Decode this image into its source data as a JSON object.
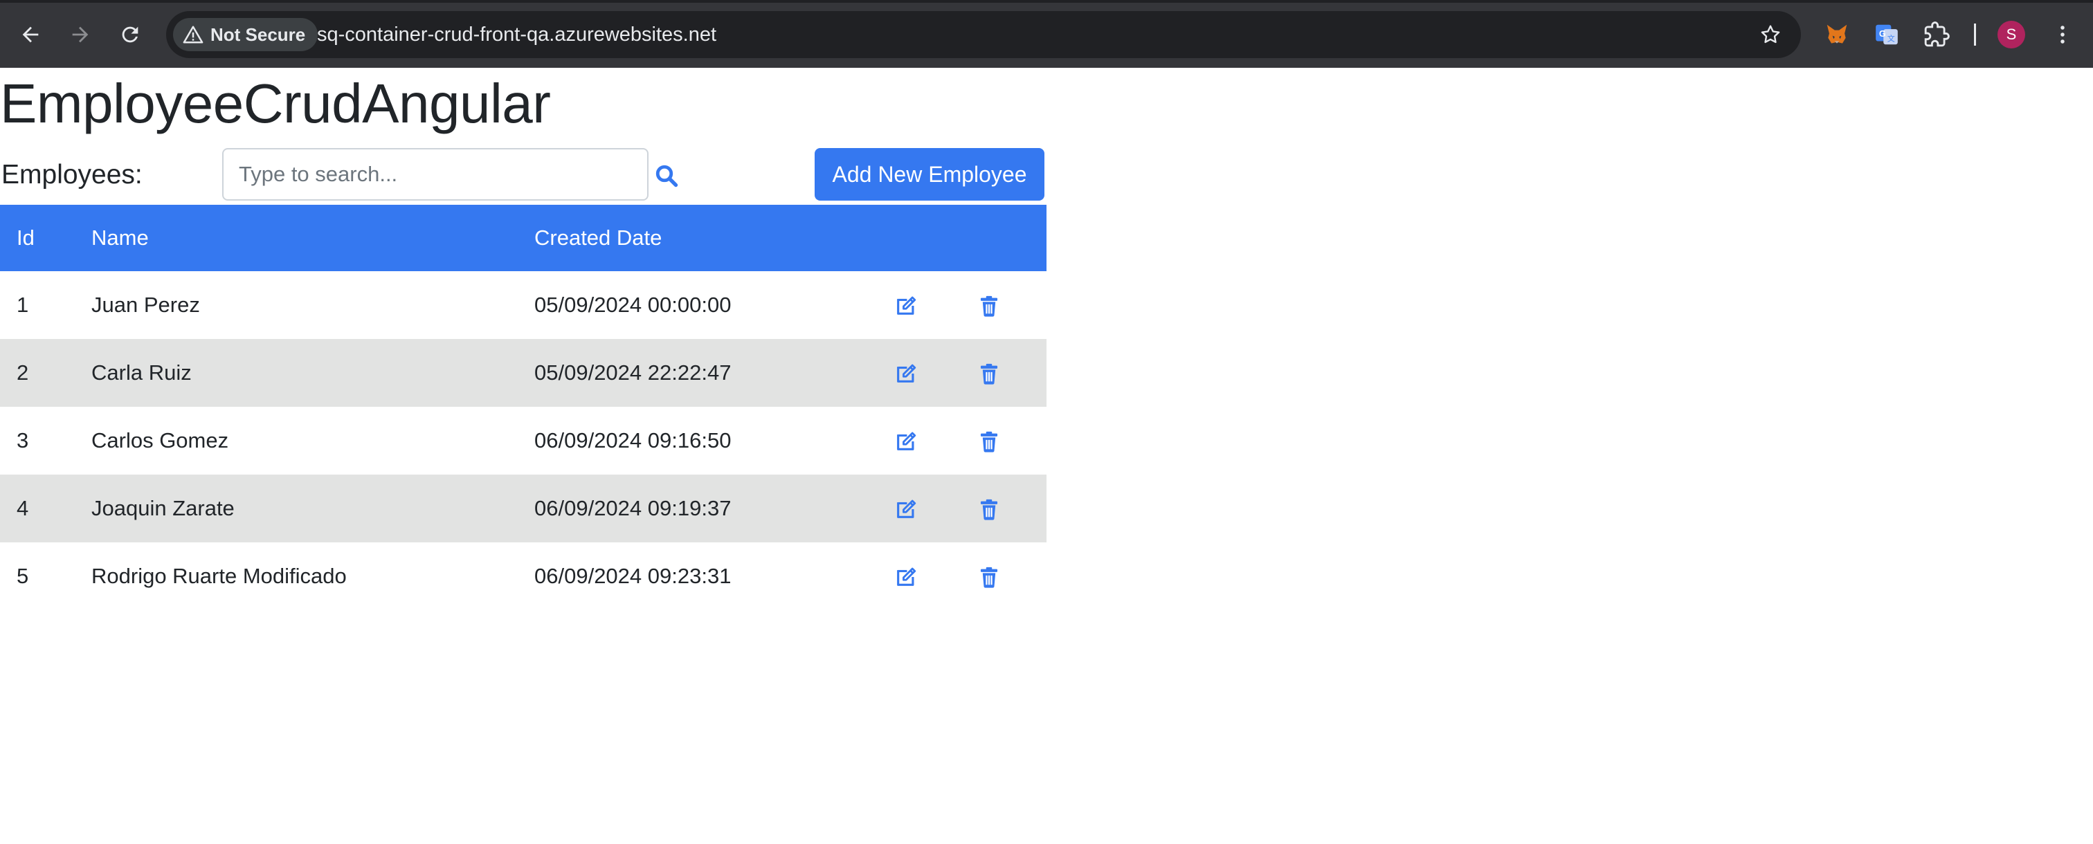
{
  "browser": {
    "security_label": "Not Secure",
    "url": "sq-container-crud-front-qa.azurewebsites.net",
    "profile_initial": "S",
    "icons": {
      "back": "arrow-left-icon",
      "forward": "arrow-right-icon",
      "reload": "reload-icon",
      "warning": "warning-triangle-icon",
      "bookmark": "star-icon",
      "extension_1": "metamask-fox-icon",
      "extension_2": "google-translate-icon",
      "extensions": "puzzle-piece-icon",
      "menu": "kebab-menu-icon"
    },
    "colors": {
      "toolbar": "#35363a",
      "omnibox": "#202124",
      "avatar": "#b0235e"
    }
  },
  "page": {
    "title": "EmployeeCrudAngular",
    "employees_label": "Employees:",
    "search": {
      "placeholder": "Type to search...",
      "value": ""
    },
    "add_button_label": "Add New Employee",
    "accent_color": "#3578f0",
    "stripe_color": "#e2e3e2"
  },
  "table": {
    "headers": {
      "id": "Id",
      "name": "Name",
      "created_date": "Created Date"
    },
    "rows": [
      {
        "id": "1",
        "name": "Juan Perez",
        "created_date": "05/09/2024 00:00:00"
      },
      {
        "id": "2",
        "name": "Carla Ruiz",
        "created_date": "05/09/2024 22:22:47"
      },
      {
        "id": "3",
        "name": "Carlos Gomez",
        "created_date": "06/09/2024 09:16:50"
      },
      {
        "id": "4",
        "name": "Joaquin Zarate",
        "created_date": "06/09/2024 09:19:37"
      },
      {
        "id": "5",
        "name": "Rodrigo Ruarte Modificado",
        "created_date": "06/09/2024 09:23:31"
      }
    ],
    "row_action_icons": {
      "edit": "edit-icon",
      "delete": "trash-icon"
    }
  }
}
